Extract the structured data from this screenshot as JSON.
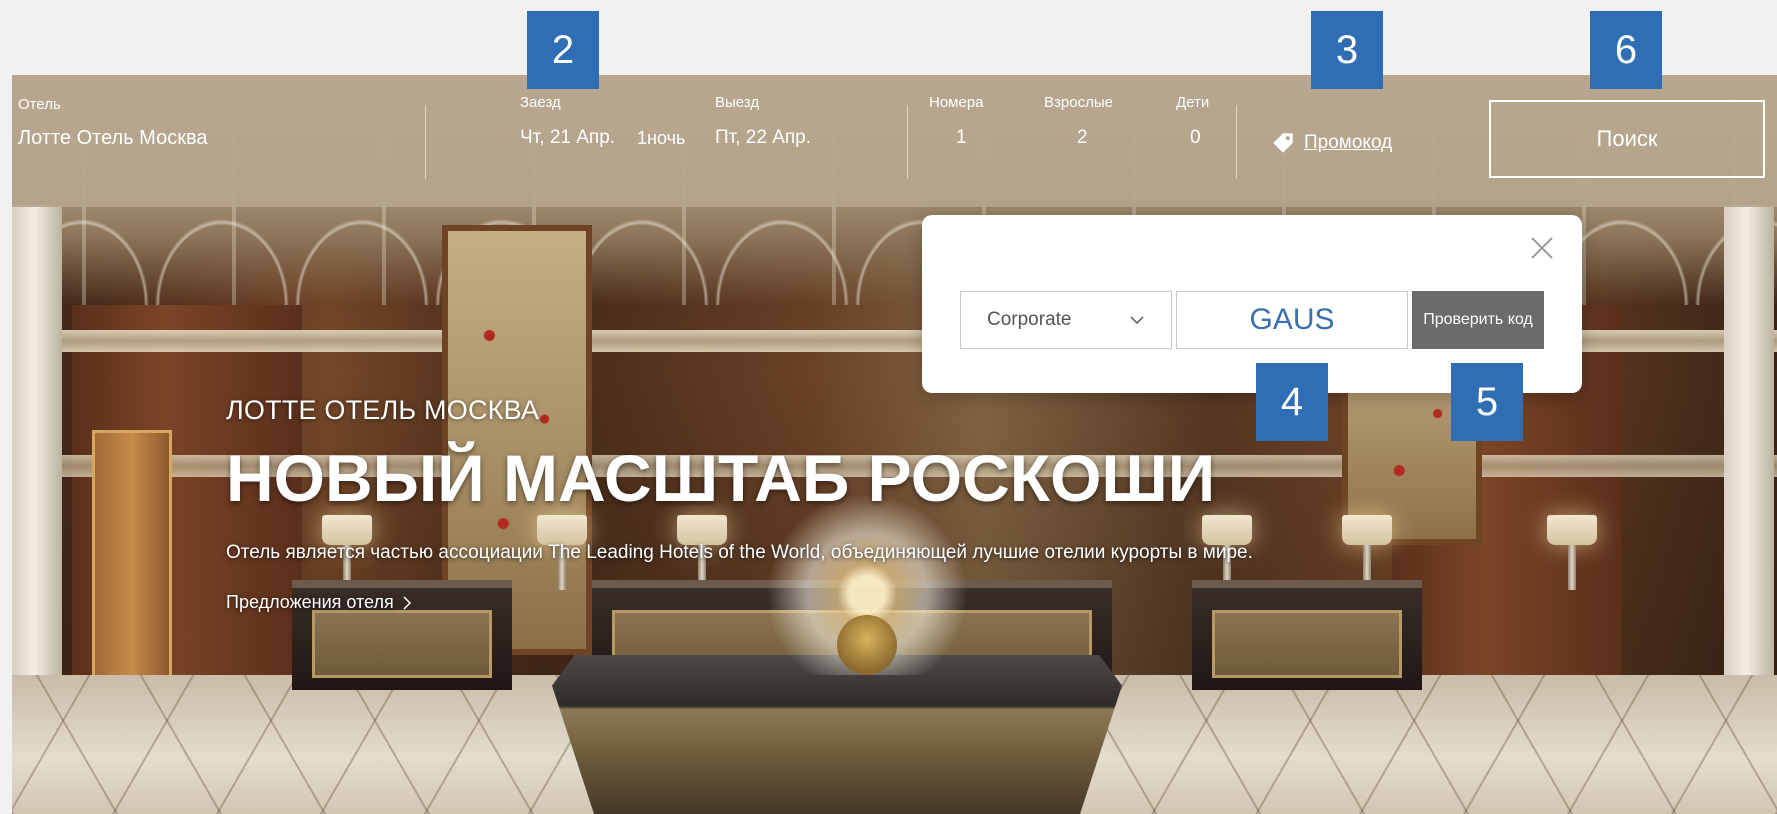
{
  "booking_bar": {
    "hotel_label": "Отель",
    "hotel_value": "Лотте Отель Москва",
    "checkin_label": "Заезд",
    "checkin_value": "Чт, 21 Апр.",
    "nights_value": "1ночь",
    "checkout_label": "Выезд",
    "checkout_value": "Пт, 22 Апр.",
    "rooms_label": "Номера",
    "rooms_value": "1",
    "adults_label": "Взрослые",
    "adults_value": "2",
    "children_label": "Дети",
    "children_value": "0",
    "promo_label": "Промокод",
    "search_label": "Поиск"
  },
  "promo_popup": {
    "type_selected": "Corporate",
    "code_value": "GAUS",
    "verify_label": "Проверить код"
  },
  "hero": {
    "subtitle": "ЛОТТЕ ОТЕЛЬ МОСКВА",
    "title": "НОВЫЙ МАСШТАБ РОСКОШИ",
    "description": "Отель является частью ассоциации The Leading Hotels of the World, объединяющей лучшие отелии курорты в мире.",
    "offers_link": "Предложения отеля"
  },
  "markers": [
    "2",
    "3",
    "6",
    "4",
    "5"
  ],
  "colors": {
    "booking_bar": "#b6a48c",
    "marker": "#2f6eb5",
    "verify_button": "#6b6b6b",
    "code_text": "#3b6fb0"
  },
  "icons": [
    "tag-icon",
    "close-icon",
    "chevron-down-icon",
    "chevron-right-icon"
  ]
}
